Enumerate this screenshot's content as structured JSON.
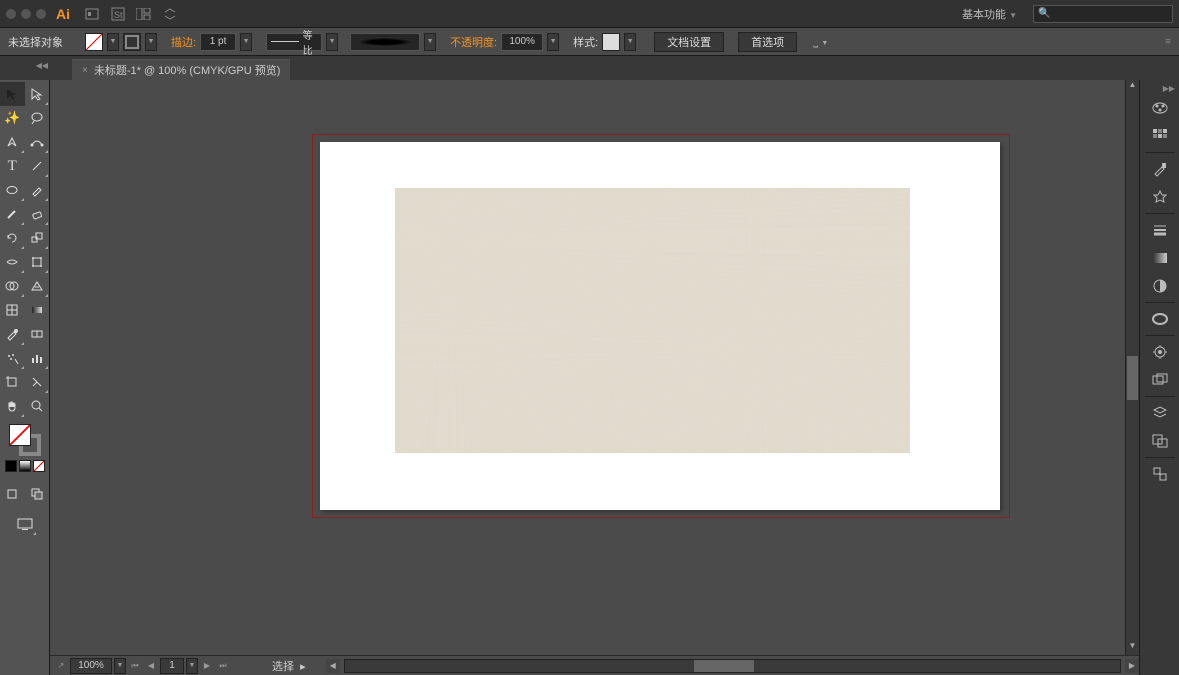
{
  "titlebar": {
    "app": "Ai",
    "workspace": "基本功能"
  },
  "search": {
    "placeholder": ""
  },
  "controlbar": {
    "no_selection": "未选择对象",
    "stroke_label": "描边:",
    "stroke_weight": "1 pt",
    "uniform": "等比",
    "opacity_label": "不透明度:",
    "opacity": "100%",
    "style_label": "样式:",
    "doc_setup": "文档设置",
    "preferences": "首选项"
  },
  "tab": {
    "title": "未标题-1* @ 100% (CMYK/GPU 预览)"
  },
  "status": {
    "zoom": "100%",
    "page": "1",
    "select_label": "选择"
  },
  "tools": [
    [
      "selection",
      "direct-selection"
    ],
    [
      "magic-wand",
      "lasso"
    ],
    [
      "pen",
      "curvature"
    ],
    [
      "type",
      "line"
    ],
    [
      "rectangle",
      "paintbrush"
    ],
    [
      "shaper",
      "eraser"
    ],
    [
      "rotate",
      "scale"
    ],
    [
      "width",
      "free-transform"
    ],
    [
      "shape-builder",
      "perspective"
    ],
    [
      "mesh",
      "gradient"
    ],
    [
      "eyedropper",
      "blend"
    ],
    [
      "symbol-sprayer",
      "graph"
    ],
    [
      "artboard",
      "slice"
    ],
    [
      "hand",
      "zoom"
    ]
  ],
  "right_panels": [
    "color",
    "swatches",
    "brushes",
    "symbols",
    "stroke",
    "properties",
    "transparency",
    "cc-libraries",
    "appearance",
    "graphic-styles",
    "layers",
    "artboards",
    "links"
  ]
}
